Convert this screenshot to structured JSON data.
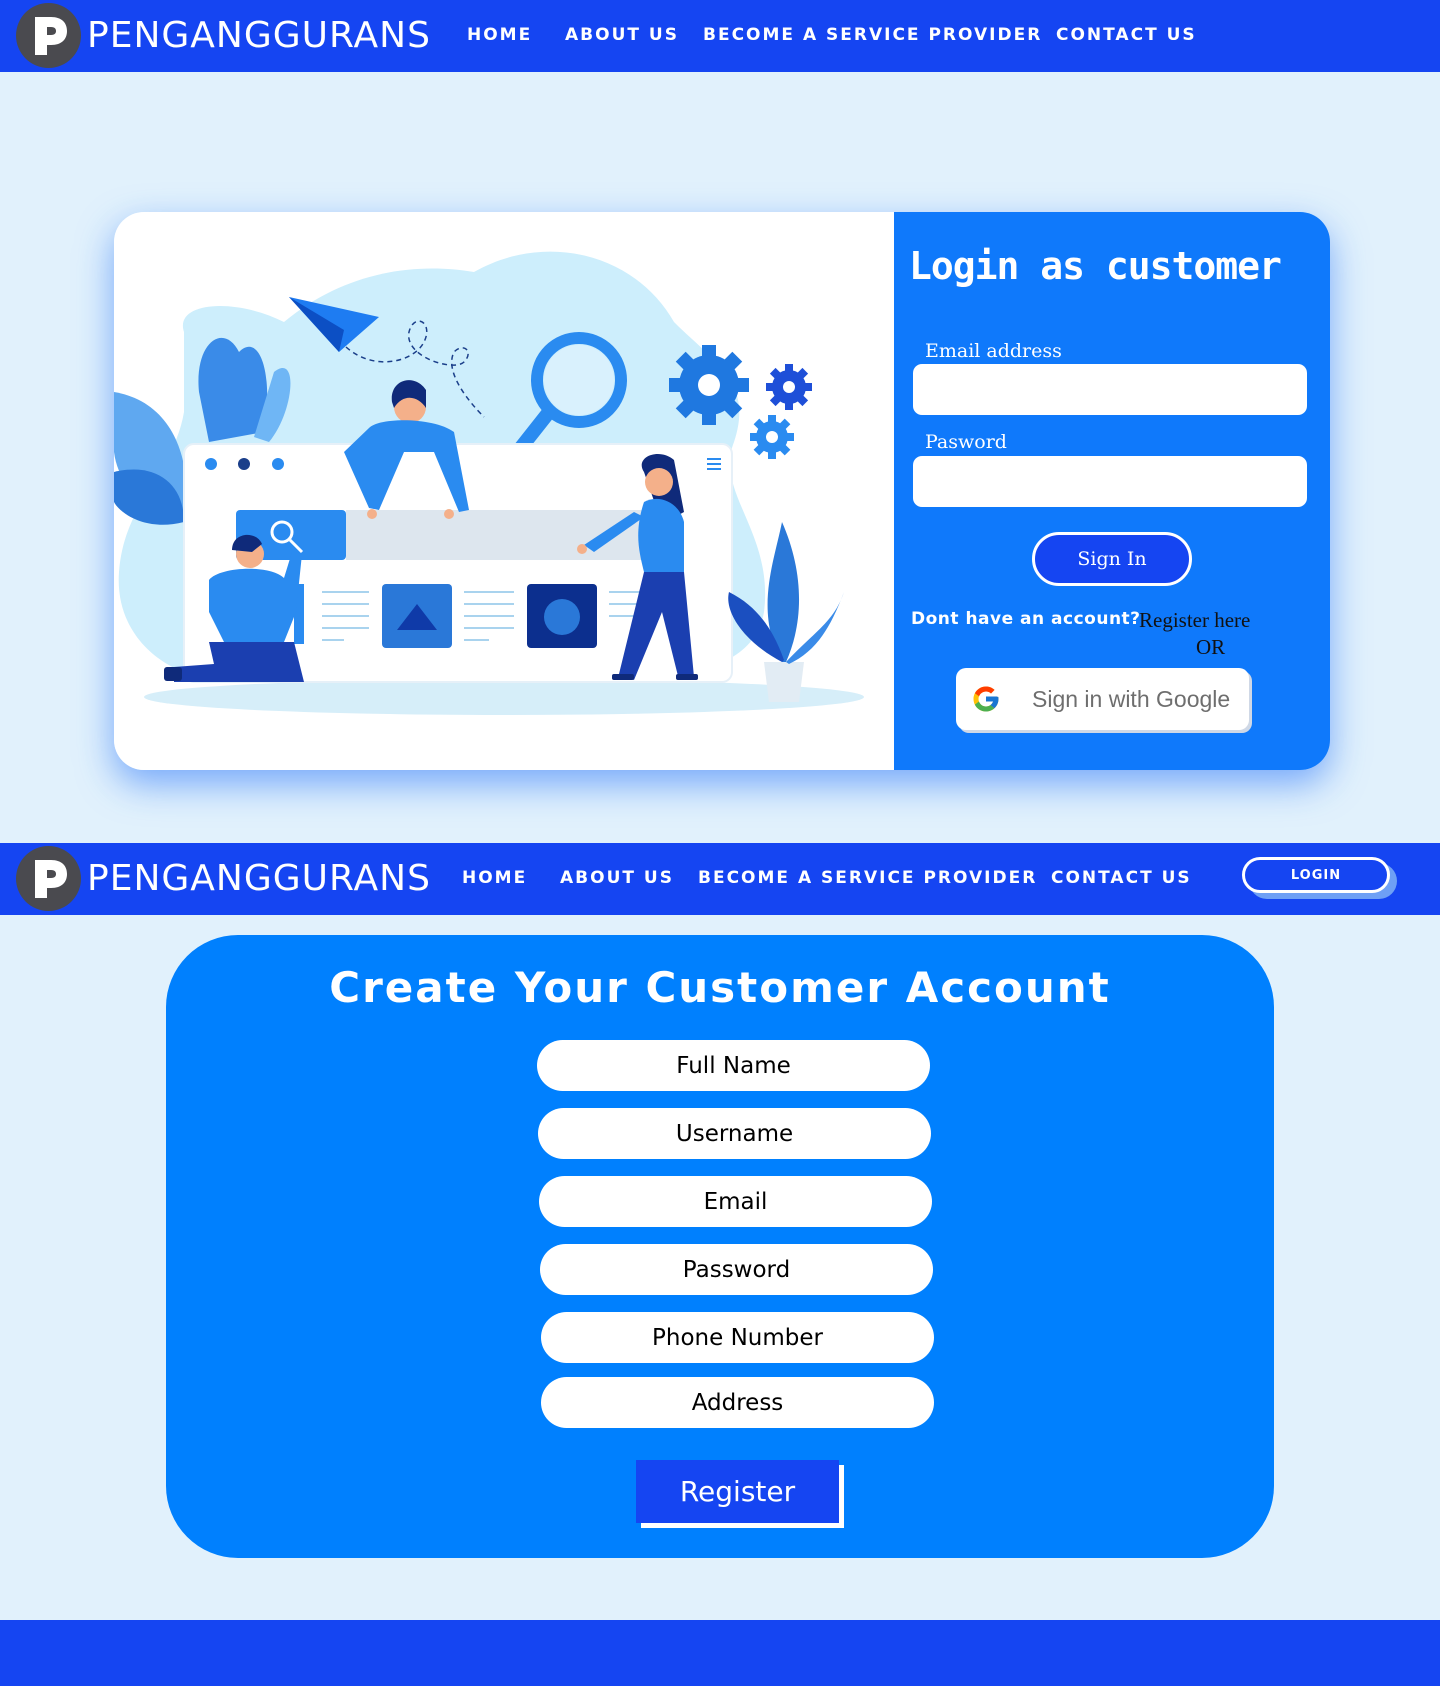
{
  "brand": {
    "name": "PENGANGGURANS"
  },
  "nav": {
    "items": [
      {
        "label": "HOME"
      },
      {
        "label": "ABOUT US"
      },
      {
        "label": "BECOME A SERVICE PROVIDER"
      },
      {
        "label": "CONTACT US"
      }
    ],
    "login_label": "LOGIN"
  },
  "login": {
    "title": "Login as customer",
    "email_label": "Email address",
    "email_value": "",
    "password_label": "Pasword",
    "password_value": "",
    "signin_label": "Sign In",
    "no_account": "Dont have an account?",
    "register_link": "Register here",
    "or": "OR",
    "google_label": "Sign in with Google"
  },
  "register": {
    "title": "Create Your Customer Account",
    "fields": [
      {
        "placeholder": "Full Name"
      },
      {
        "placeholder": "Username"
      },
      {
        "placeholder": "Email"
      },
      {
        "placeholder": "Password"
      },
      {
        "placeholder": "Phone Number"
      },
      {
        "placeholder": "Address"
      }
    ],
    "button": "Register"
  },
  "colors": {
    "nav_bg": "#1545f2",
    "page_bg": "#e1f1fc",
    "card_blue": "#0f79fb",
    "register_card": "#0080fe",
    "logo_circle": "#4a4a4f"
  },
  "icons": [
    "brand-logo-icon",
    "google-g-icon",
    "hero-illustration"
  ]
}
